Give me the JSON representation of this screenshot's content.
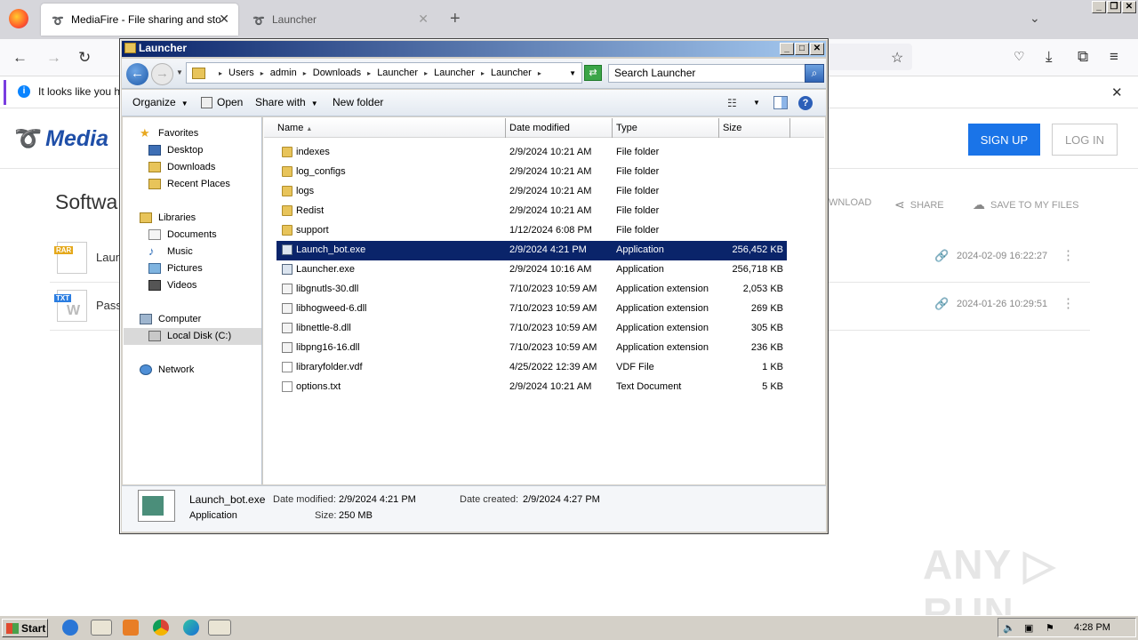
{
  "browser": {
    "tabs": [
      {
        "label": "MediaFire - File sharing and storage"
      },
      {
        "label": "Launcher"
      }
    ],
    "infobar_text": "It looks like you ha"
  },
  "mediafire": {
    "logo_text": "Media",
    "signup_label": "SIGN UP",
    "login_label": "LOG IN",
    "folder_title": "Softwa",
    "actions": {
      "download": "WNLOAD",
      "share": "SHARE",
      "save": "SAVE TO MY FILES"
    },
    "files": [
      {
        "tag": "RAR",
        "name": "Laun",
        "date": "2024-02-09 16:22:27",
        "tag_color": "#e5a81a"
      },
      {
        "tag": "TXT",
        "name": "Pass",
        "date": "2024-01-26 10:29:51",
        "tag_color": "#2a7de1"
      }
    ],
    "watermark": "ANY ▷ RUN"
  },
  "explorer": {
    "title": "Launcher",
    "breadcrumbs": [
      "Users",
      "admin",
      "Downloads",
      "Launcher",
      "Launcher",
      "Launcher"
    ],
    "search_placeholder": "Search Launcher",
    "commands": {
      "organize": "Organize",
      "open": "Open",
      "share_with": "Share with",
      "new_folder": "New folder"
    },
    "nav": {
      "favorites": "Favorites",
      "desktop": "Desktop",
      "downloads": "Downloads",
      "recent": "Recent Places",
      "libraries": "Libraries",
      "documents": "Documents",
      "music": "Music",
      "pictures": "Pictures",
      "videos": "Videos",
      "computer": "Computer",
      "local_disk": "Local Disk (C:)",
      "network": "Network"
    },
    "columns": {
      "name": "Name",
      "date": "Date modified",
      "type": "Type",
      "size": "Size"
    },
    "files": [
      {
        "name": "indexes",
        "date": "2/9/2024 10:21 AM",
        "type": "File folder",
        "size": "",
        "kind": "folder"
      },
      {
        "name": "log_configs",
        "date": "2/9/2024 10:21 AM",
        "type": "File folder",
        "size": "",
        "kind": "folder"
      },
      {
        "name": "logs",
        "date": "2/9/2024 10:21 AM",
        "type": "File folder",
        "size": "",
        "kind": "folder"
      },
      {
        "name": "Redist",
        "date": "2/9/2024 10:21 AM",
        "type": "File folder",
        "size": "",
        "kind": "folder"
      },
      {
        "name": "support",
        "date": "1/12/2024 6:08 PM",
        "type": "File folder",
        "size": "",
        "kind": "folder"
      },
      {
        "name": "Launch_bot.exe",
        "date": "2/9/2024 4:21 PM",
        "type": "Application",
        "size": "256,452 KB",
        "kind": "exe",
        "selected": true
      },
      {
        "name": "Launcher.exe",
        "date": "2/9/2024 10:16 AM",
        "type": "Application",
        "size": "256,718 KB",
        "kind": "exe"
      },
      {
        "name": "libgnutls-30.dll",
        "date": "7/10/2023 10:59 AM",
        "type": "Application extension",
        "size": "2,053 KB",
        "kind": "dll"
      },
      {
        "name": "libhogweed-6.dll",
        "date": "7/10/2023 10:59 AM",
        "type": "Application extension",
        "size": "269 KB",
        "kind": "dll"
      },
      {
        "name": "libnettle-8.dll",
        "date": "7/10/2023 10:59 AM",
        "type": "Application extension",
        "size": "305 KB",
        "kind": "dll"
      },
      {
        "name": "libpng16-16.dll",
        "date": "7/10/2023 10:59 AM",
        "type": "Application extension",
        "size": "236 KB",
        "kind": "dll"
      },
      {
        "name": "libraryfolder.vdf",
        "date": "4/25/2022 12:39 AM",
        "type": "VDF File",
        "size": "1 KB",
        "kind": "file"
      },
      {
        "name": "options.txt",
        "date": "2/9/2024 10:21 AM",
        "type": "Text Document",
        "size": "5 KB",
        "kind": "file"
      }
    ],
    "details": {
      "name": "Launch_bot.exe",
      "type": "Application",
      "modified_label": "Date modified:",
      "modified": "2/9/2024 4:21 PM",
      "created_label": "Date created:",
      "created": "2/9/2024 4:27 PM",
      "size_label": "Size:",
      "size": "250 MB"
    }
  },
  "taskbar": {
    "start": "Start",
    "clock": "4:28 PM"
  }
}
